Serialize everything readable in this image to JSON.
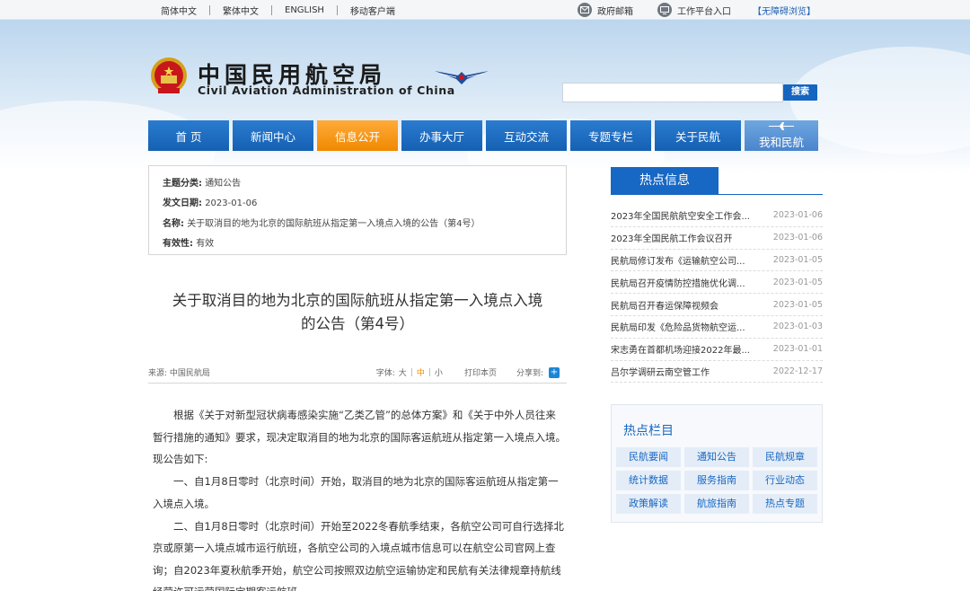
{
  "topbar": {
    "lang_simplified": "简体中文",
    "lang_traditional": "繁体中文",
    "lang_english": "ENGLISH",
    "mobile_client": "移动客户端",
    "gov_mail": "政府邮箱",
    "workbench": "工作平台入口",
    "accessibility": "【无障碍浏览】"
  },
  "header": {
    "title_cn": "中国民用航空局",
    "title_en": "Civil Aviation Administration of China",
    "search_placeholder": "",
    "search_button": "搜索"
  },
  "nav": {
    "items": [
      "首  页",
      "新闻中心",
      "信息公开",
      "办事大厅",
      "互动交流",
      "专题专栏",
      "关于民航",
      "我和民航"
    ],
    "active_index": 2
  },
  "meta": {
    "category_label": "主题分类:",
    "category_value": "通知公告",
    "date_label": "发文日期:",
    "date_value": "2023-01-06",
    "name_label": "名称:",
    "name_value": "关于取消目的地为北京的国际航班从指定第一入境点入境的公告（第4号）",
    "validity_label": "有效性:",
    "validity_value": "有效"
  },
  "article": {
    "title_line1": "关于取消目的地为北京的国际航班从指定第一入境点入境",
    "title_line2": "的公告（第4号）",
    "source": "来源: 中国民航局",
    "fontsize_label": "字体:",
    "fs_large": "大",
    "fs_medium": "中",
    "fs_small": "小",
    "print": "打印本页",
    "share": "分享到:",
    "paragraphs": [
      "根据《关于对新型冠状病毒感染实施“乙类乙管”的总体方案》和《关于中外人员往来暂行措施的通知》要求，现决定取消目的地为北京的国际客运航班从指定第一入境点入境。现公告如下:",
      "一、自1月8日零时（北京时间）开始，取消目的地为北京的国际客运航班从指定第一入境点入境。",
      "二、自1月8日零时（北京时间）开始至2022冬春航季结束，各航空公司可自行选择北京或原第一入境点城市运行航班，各航空公司的入境点城市信息可以在航空公司官网上查询；自2023年夏秋航季开始，航空公司按照双边航空运输协定和民航有关法律规章持航线经营许可运营国际定期客运航班。"
    ]
  },
  "sidebar": {
    "hot_info_title": "热点信息",
    "hot_items": [
      {
        "title": "2023年全国民航航空安全工作会...",
        "date": "2023-01-06"
      },
      {
        "title": "2023年全国民航工作会议召开",
        "date": "2023-01-06"
      },
      {
        "title": "民航局修订发布《运输航空公司...",
        "date": "2023-01-05"
      },
      {
        "title": "民航局召开疫情防控措施优化调...",
        "date": "2023-01-05"
      },
      {
        "title": "民航局召开春运保障视频会",
        "date": "2023-01-05"
      },
      {
        "title": "民航局印发《危险品货物航空运...",
        "date": "2023-01-03"
      },
      {
        "title": "宋志勇在首都机场迎接2022年最...",
        "date": "2023-01-01"
      },
      {
        "title": "吕尔学调研云南空管工作",
        "date": "2022-12-17"
      }
    ],
    "hot_column_title": "热点栏目",
    "columns": [
      "民航要闻",
      "通知公告",
      "民航规章",
      "统计数据",
      "服务指南",
      "行业动态",
      "政策解读",
      "航旅指南",
      "热点专题"
    ]
  },
  "colors": {
    "nav_blue": "#1665c0",
    "nav_active_orange": "#f39000",
    "accent_blue": "#1767c4"
  }
}
